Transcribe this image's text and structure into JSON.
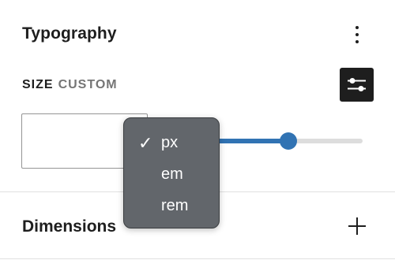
{
  "panel": {
    "title": "Typography"
  },
  "size": {
    "label": "SIZE",
    "mode": "CUSTOM",
    "value": ""
  },
  "slider": {
    "value_fraction": 0.59,
    "fill_color": "#3173b3",
    "track_color": "#dddddd"
  },
  "unit_menu": {
    "options": [
      {
        "label": "px",
        "selected": true
      },
      {
        "label": "em",
        "selected": false
      },
      {
        "label": "rem",
        "selected": false
      }
    ],
    "check_glyph": "✓"
  },
  "dimensions": {
    "title": "Dimensions"
  },
  "icons": {
    "more": "more-vertical-icon",
    "settings": "sliders-settings-icon",
    "add": "plus-icon",
    "check": "check-icon"
  }
}
